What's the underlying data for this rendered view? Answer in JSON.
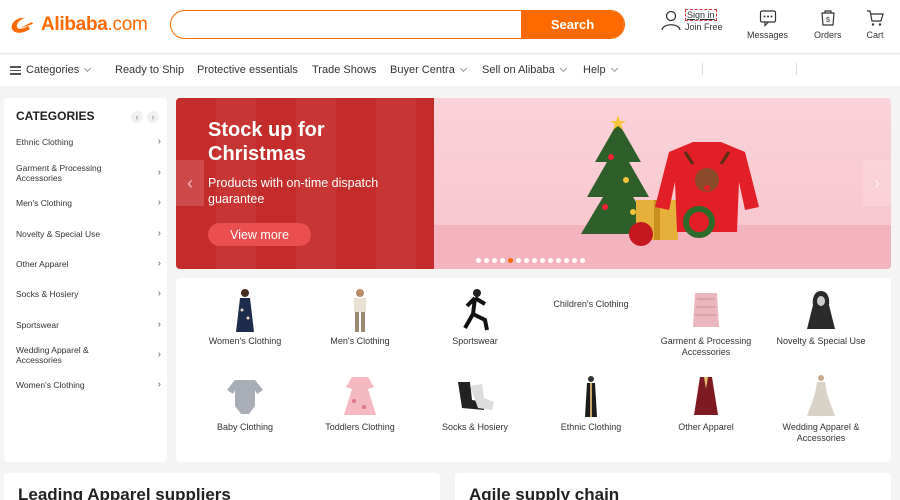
{
  "logo": {
    "name": "Alibaba",
    "suffix": ".com"
  },
  "search": {
    "placeholder": "",
    "button": "Search"
  },
  "header": {
    "sign_in": "Sign in",
    "join_free": "Join Free",
    "messages": "Messages",
    "orders": "Orders",
    "cart": "Cart"
  },
  "nav": {
    "categories": "Categories",
    "items": [
      "Ready to Ship",
      "Protective essentials",
      "Trade Shows",
      "Buyer Centra",
      "Sell on Alibaba",
      "Help"
    ]
  },
  "sidebar": {
    "title": "CATEGORIES",
    "items": [
      {
        "label": "Ethnic Clothing"
      },
      {
        "label": "Garment & Processing Accessories"
      },
      {
        "label": "Men's Clothing"
      },
      {
        "label": "Novelty & Special Use"
      },
      {
        "label": "Other Apparel"
      },
      {
        "label": "Socks & Hosiery"
      },
      {
        "label": "Sportswear"
      },
      {
        "label": "Wedding Apparel & Accessories"
      },
      {
        "label": "Women's Clothing"
      }
    ]
  },
  "banner": {
    "title": "Stock up for Christmas",
    "subtitle": "Products with on-time dispatch guarantee",
    "cta": "View more",
    "slide_count": 14,
    "active_slide": 4
  },
  "products": [
    {
      "label": "Women's Clothing",
      "icon": "dress-icon"
    },
    {
      "label": "Men's Clothing",
      "icon": "man-icon"
    },
    {
      "label": "Sportswear",
      "icon": "runner-icon"
    },
    {
      "label": "Children's Clothing",
      "icon": ""
    },
    {
      "label": "Garment & Processing Accessories",
      "icon": "fabric-icon"
    },
    {
      "label": "Novelty & Special Use",
      "icon": "costume-icon"
    },
    {
      "label": "Baby Clothing",
      "icon": "romper-icon"
    },
    {
      "label": "Toddlers Clothing",
      "icon": "kids-dress-icon"
    },
    {
      "label": "Socks & Hosiery",
      "icon": "socks-icon"
    },
    {
      "label": "Ethnic Clothing",
      "icon": "abaya-icon"
    },
    {
      "label": "Other Apparel",
      "icon": "robe-icon"
    },
    {
      "label": "Wedding Apparel & Accessories",
      "icon": "wedding-dress-icon"
    }
  ],
  "cards": {
    "left_title": "Leading Apparel suppliers",
    "right_title": "Agile supply chain"
  },
  "colors": {
    "brand": "#ff6a00",
    "banner_red": "#c42b2b",
    "banner_pink": "#f8c7cf"
  }
}
